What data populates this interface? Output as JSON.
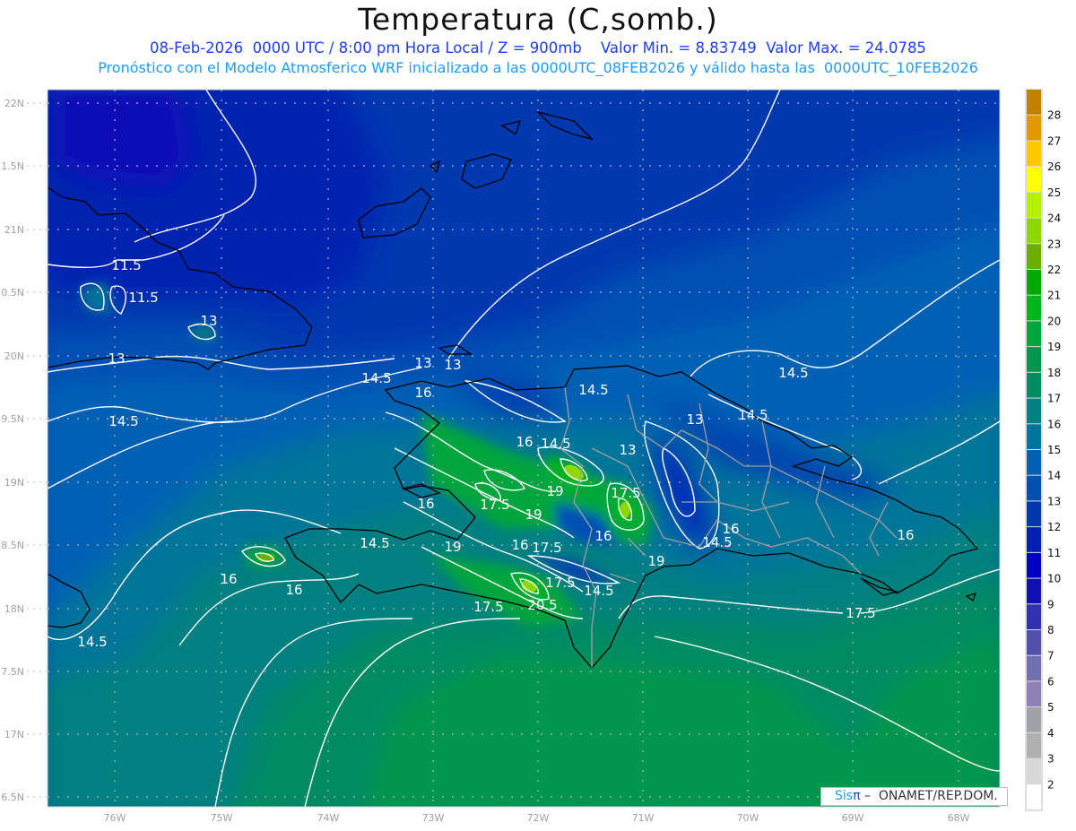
{
  "header": {
    "title": "Temperatura (C,somb.)",
    "subtitle": "08-Feb-2026  0000 UTC / 8:00 pm Hora Local / Z = 900mb    Valor Min. = 8.83749  Valor Max. = 24.0785",
    "model_info": "Pronóstico con el Modelo Atmosferico WRF inicializado a las 0000UTC_08FEB2026 y válido hasta las  0000UTC_10FEB2026"
  },
  "map": {
    "lon_labels": [
      "76W",
      "75W",
      "74W",
      "73W",
      "72W",
      "71W",
      "70W",
      "69W",
      "68W"
    ],
    "lat_labels": [
      "22N",
      "1.5N",
      "21N",
      "0.5N",
      "20N",
      "9.5N",
      "19N",
      "8.5N",
      "18N",
      "7.5N",
      "17N",
      "6.5N"
    ],
    "contour_labels": [
      "11.5",
      "11.5",
      "13",
      "13",
      "14.5",
      "14.5",
      "13",
      "13",
      "16",
      "14.5",
      "13",
      "14.5",
      "14.5",
      "16",
      "14.5",
      "13",
      "19",
      "17.5",
      "17.5",
      "19",
      "16",
      "14.5",
      "19",
      "16",
      "17.5",
      "16",
      "16",
      "14.5",
      "16",
      "19",
      "17.5",
      "14.5",
      "20.5",
      "17.5",
      "16",
      "16",
      "14.5",
      "17.5"
    ],
    "contour_color": "#ffffff",
    "coastline_color": "#000000",
    "border_color": "#a0a0a0"
  },
  "colorbar": {
    "labels": [
      "28",
      "27",
      "26",
      "25",
      "24",
      "23",
      "22",
      "21",
      "20",
      "19",
      "18",
      "17",
      "16",
      "15",
      "14",
      "13",
      "12",
      "11",
      "10",
      "9",
      "8",
      "7",
      "6",
      "5",
      "4",
      "3",
      "2"
    ],
    "colors": [
      "#c08000",
      "#e09a00",
      "#ffc800",
      "#ffff00",
      "#b4f000",
      "#8cd800",
      "#6aaf00",
      "#00aa00",
      "#00b41e",
      "#00a53c",
      "#00964b",
      "#008a64",
      "#008080",
      "#00749a",
      "#0060b4",
      "#0050b4",
      "#0038b0",
      "#0020b0",
      "#0000c0",
      "#1010b0",
      "#3030b0",
      "#5050a8",
      "#7070b0",
      "#9080b8",
      "#a0a0a8",
      "#b0b0b0",
      "#d8d8d8",
      "#ffffff"
    ]
  },
  "footer": {
    "logo_sis": "Sis",
    "logo_pi": "π",
    "text": " –  ONAMET/REP.DOM."
  }
}
